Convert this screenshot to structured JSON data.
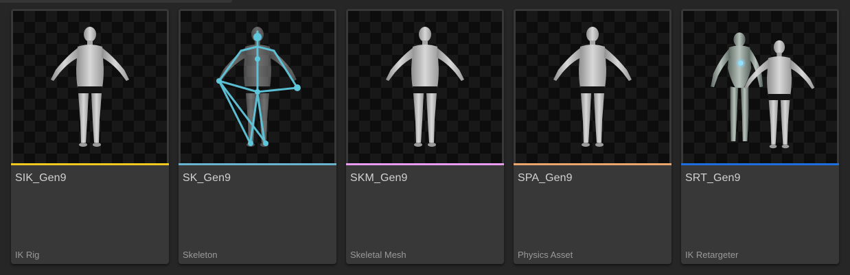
{
  "assets": [
    {
      "name": "SIK_Gen9",
      "type": "IK Rig",
      "color": "#f0c81e",
      "icon": "mannequin-thumbnail"
    },
    {
      "name": "SK_Gen9",
      "type": "Skeleton",
      "color": "#6ab4d0",
      "icon": "skeleton-thumbnail"
    },
    {
      "name": "SKM_Gen9",
      "type": "Skeletal Mesh",
      "color": "#e89bef",
      "icon": "mannequin-thumbnail"
    },
    {
      "name": "SPA_Gen9",
      "type": "Physics Asset",
      "color": "#eaa66c",
      "icon": "mannequin-thumbnail"
    },
    {
      "name": "SRT_Gen9",
      "type": "IK Retargeter",
      "color": "#1e6ee0",
      "icon": "retarget-thumbnail"
    }
  ]
}
